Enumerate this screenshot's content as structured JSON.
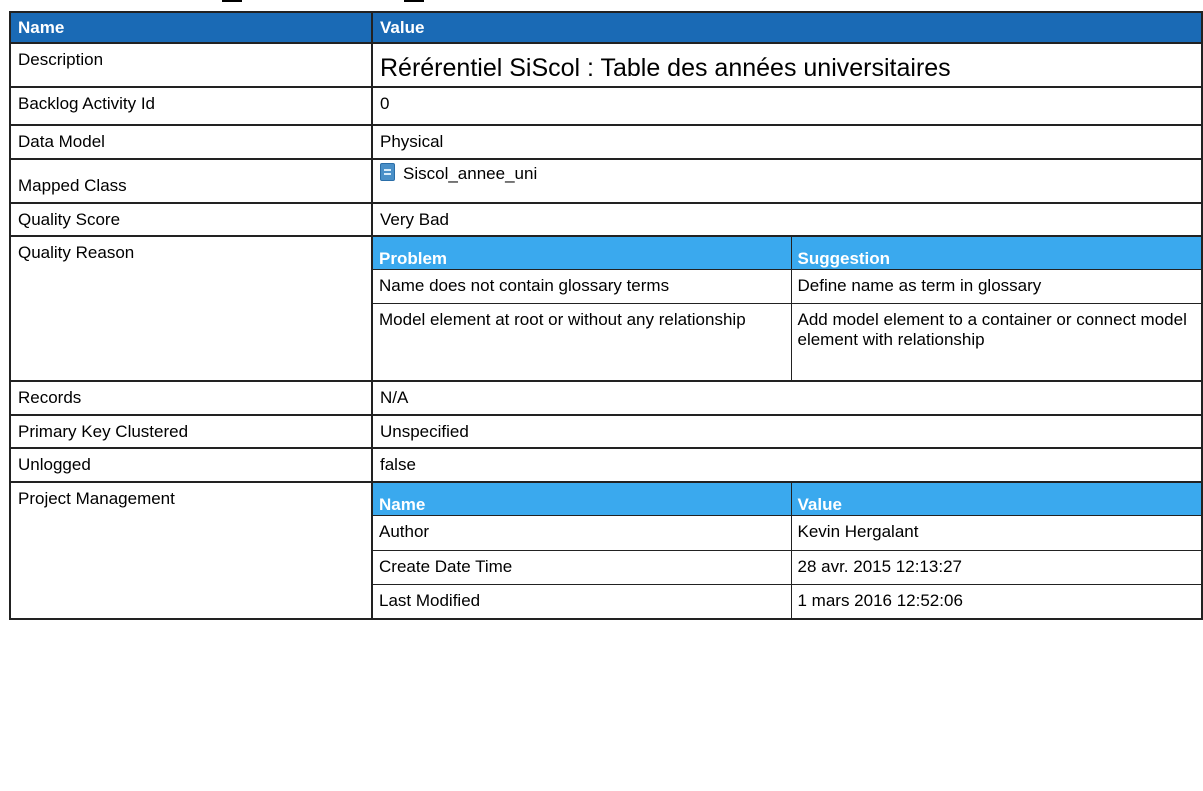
{
  "table": {
    "header": {
      "name": "Name",
      "value": "Value"
    },
    "rows": {
      "description": {
        "key": "Description",
        "value": "Rérérentiel SiScol : Table des années universitaires"
      },
      "backlog": {
        "key": "Backlog Activity Id",
        "value": "0"
      },
      "data_model": {
        "key": "Data Model",
        "value": "Physical"
      },
      "mapped_class": {
        "key": "Mapped Class",
        "value": "Siscol_annee_uni",
        "icon": "class-icon"
      },
      "quality_score": {
        "key": "Quality Score",
        "value": "Very Bad"
      },
      "quality_reason": {
        "key": "Quality Reason",
        "headers": [
          "Problem",
          "Suggestion"
        ],
        "rows": [
          [
            "Name does not contain glossary terms",
            "Define name as term in glossary"
          ],
          [
            "Model element at root or without any relationship",
            "Add model element to a container or connect model element with relationship"
          ]
        ]
      },
      "records": {
        "key": "Records",
        "value": "N/A"
      },
      "pk_clustered": {
        "key": "Primary Key Clustered",
        "value": "Unspecified"
      },
      "unlogged": {
        "key": "Unlogged",
        "value": "false"
      },
      "project_management": {
        "key": "Project Management",
        "headers": [
          "Name",
          "Value"
        ],
        "rows": [
          [
            "Author",
            "Kevin Hergalant"
          ],
          [
            "Create Date Time",
            "28 avr. 2015 12:13:27"
          ],
          [
            "Last Modified",
            "1 mars 2016 12:52:06"
          ]
        ]
      }
    }
  },
  "colors": {
    "outer_header": "#1a6ab5",
    "inner_header": "#3aa9ee",
    "border": "#222222"
  }
}
